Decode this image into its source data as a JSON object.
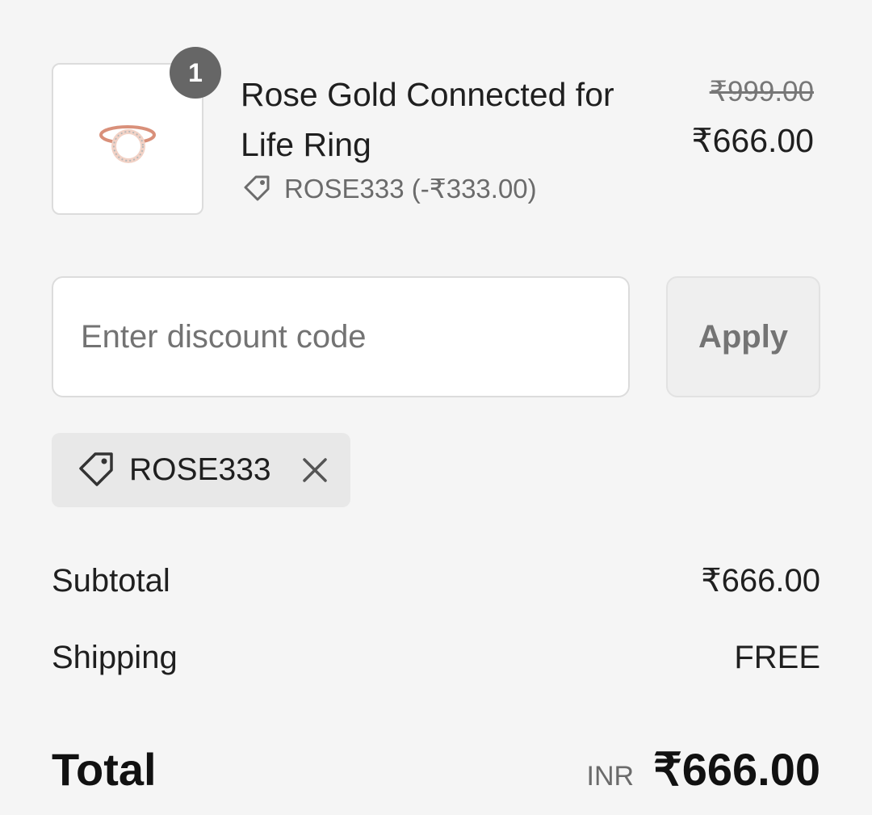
{
  "line_item": {
    "quantity": "1",
    "title": "Rose Gold Connected for Life Ring",
    "discount_label": "ROSE333 (-₹333.00)",
    "original_price": "₹999.00",
    "final_price": "₹666.00",
    "image_icon": "ring-product-image"
  },
  "discount_form": {
    "placeholder": "Enter discount code",
    "value": "",
    "apply_label": "Apply"
  },
  "applied_code": {
    "code": "ROSE333",
    "tag_icon": "tag-icon",
    "remove_icon": "close-icon"
  },
  "summary": {
    "subtotal_label": "Subtotal",
    "subtotal_value": "₹666.00",
    "shipping_label": "Shipping",
    "shipping_value": "FREE",
    "total_label": "Total",
    "currency": "INR",
    "total_value": "₹666.00"
  },
  "colors": {
    "background": "#f5f5f5",
    "badge": "#666666",
    "chip": "#e8e8e8",
    "ring": "#d9907a"
  }
}
